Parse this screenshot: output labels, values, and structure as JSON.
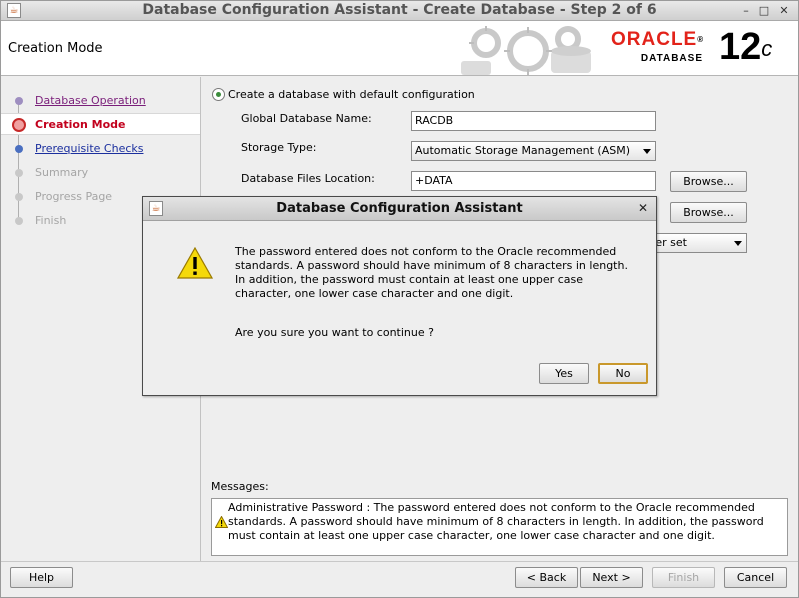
{
  "window": {
    "title": "Database Configuration Assistant - Create Database - Step 2 of 6",
    "app_icon": "java-coffee-icon",
    "controls": {
      "minimize": "–",
      "maximize": "□",
      "close": "✕"
    }
  },
  "header": {
    "step_title": "Creation Mode",
    "logo_brand": "ORACLE",
    "logo_registered": "®",
    "logo_sub": "DATABASE",
    "version": "12",
    "version_suffix": "c"
  },
  "sidebar": {
    "steps": [
      {
        "label": "Database Operation",
        "state": "done"
      },
      {
        "label": "Creation Mode",
        "state": "current"
      },
      {
        "label": "Prerequisite Checks",
        "state": "link"
      },
      {
        "label": "Summary",
        "state": "disabled"
      },
      {
        "label": "Progress Page",
        "state": "disabled"
      },
      {
        "label": "Finish",
        "state": "disabled"
      }
    ]
  },
  "form": {
    "option_default": "Create a database with default configuration",
    "global_db_name_label": "Global Database Name:",
    "global_db_name_value": "RACDB",
    "storage_type_label": "Storage Type:",
    "storage_type_value": "Automatic Storage Management (ASM)",
    "db_files_location_label": "Database Files Location:",
    "db_files_location_value": "+DATA",
    "browse_label": "Browse...",
    "browse2_label": "Browse...",
    "charset_partial": "ter set"
  },
  "messages": {
    "label": "Messages:",
    "text": "Administrative Password : The password entered does not conform to the Oracle recommended standards. A password should have minimum of 8 characters in length. In addition, the password must contain at least one upper case character, one lower case character and one digit."
  },
  "dialog": {
    "title": "Database Configuration Assistant",
    "close": "✕",
    "message": "The password entered does not conform to the Oracle recommended standards. A password should have minimum of 8 characters in length. In addition, the password must contain at least one upper case character, one lower case character and one digit.",
    "question": "Are you sure you want to continue ?",
    "yes_label": "Yes",
    "no_label": "No"
  },
  "footer": {
    "help_label": "Help",
    "back_label": "< Back",
    "next_label": "Next >",
    "finish_label": "Finish",
    "cancel_label": "Cancel"
  },
  "colors": {
    "oracle_red": "#e2231a",
    "current_step": "#c2001c",
    "link_blue": "#1b2f9e",
    "done_purple": "#7a1e7a",
    "warning_yellow": "#f5d90a",
    "default_button_border": "#c9982c"
  }
}
